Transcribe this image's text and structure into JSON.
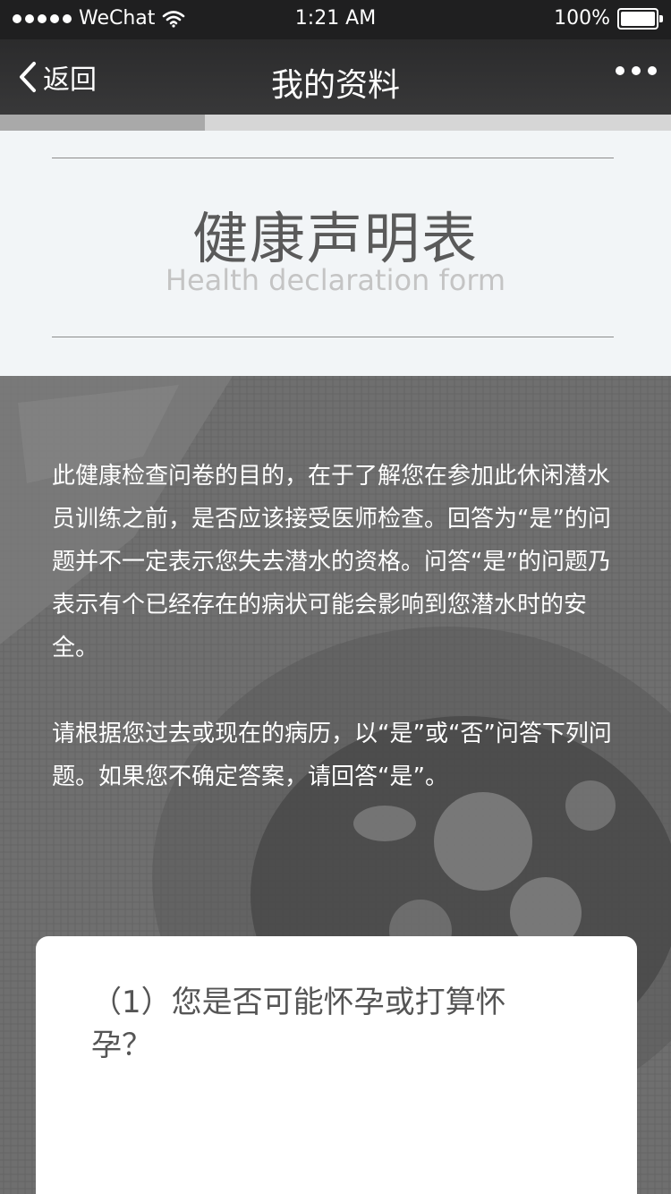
{
  "status_bar": {
    "carrier": "WeChat",
    "time": "1:21 AM",
    "battery": "100%",
    "icons": [
      "signal-dots-icon",
      "wifi-icon",
      "battery-icon"
    ]
  },
  "nav": {
    "back_label": "返回",
    "title": "我的资料",
    "icons": [
      "chevron-left-icon",
      "more-dots-icon"
    ]
  },
  "progress": {
    "value": 0.305
  },
  "header": {
    "title_cn": "健康声明表",
    "title_en": "Health declaration form"
  },
  "intro": {
    "paragraph1": " 此健康检查问卷的目的，在于了解您在参加此休闲潜水员训练之前，是否应该接受医师检查。回答为“是”的问题并不一定表示您失去潜水的资格。问答“是”的问题乃表示有个已经存在的病状可能会影响到您潜水时的安全。",
    "paragraph2": "请根据您过去或现在的病历，以“是”或“否”问答下列问题。如果您不确定答案，请回答“是”。"
  },
  "question": {
    "text": "（1）您是否可能怀孕或打算怀孕？"
  },
  "colors": {
    "status_bg": "#1f1f20",
    "nav_bg": "#333334",
    "progress_fill": "#a9a9a9",
    "progress_track": "#d6d6d6",
    "title_text": "#5a5a5a",
    "subtitle_text": "#c4c4c4",
    "overlay_bg": "#6e6e6e"
  }
}
